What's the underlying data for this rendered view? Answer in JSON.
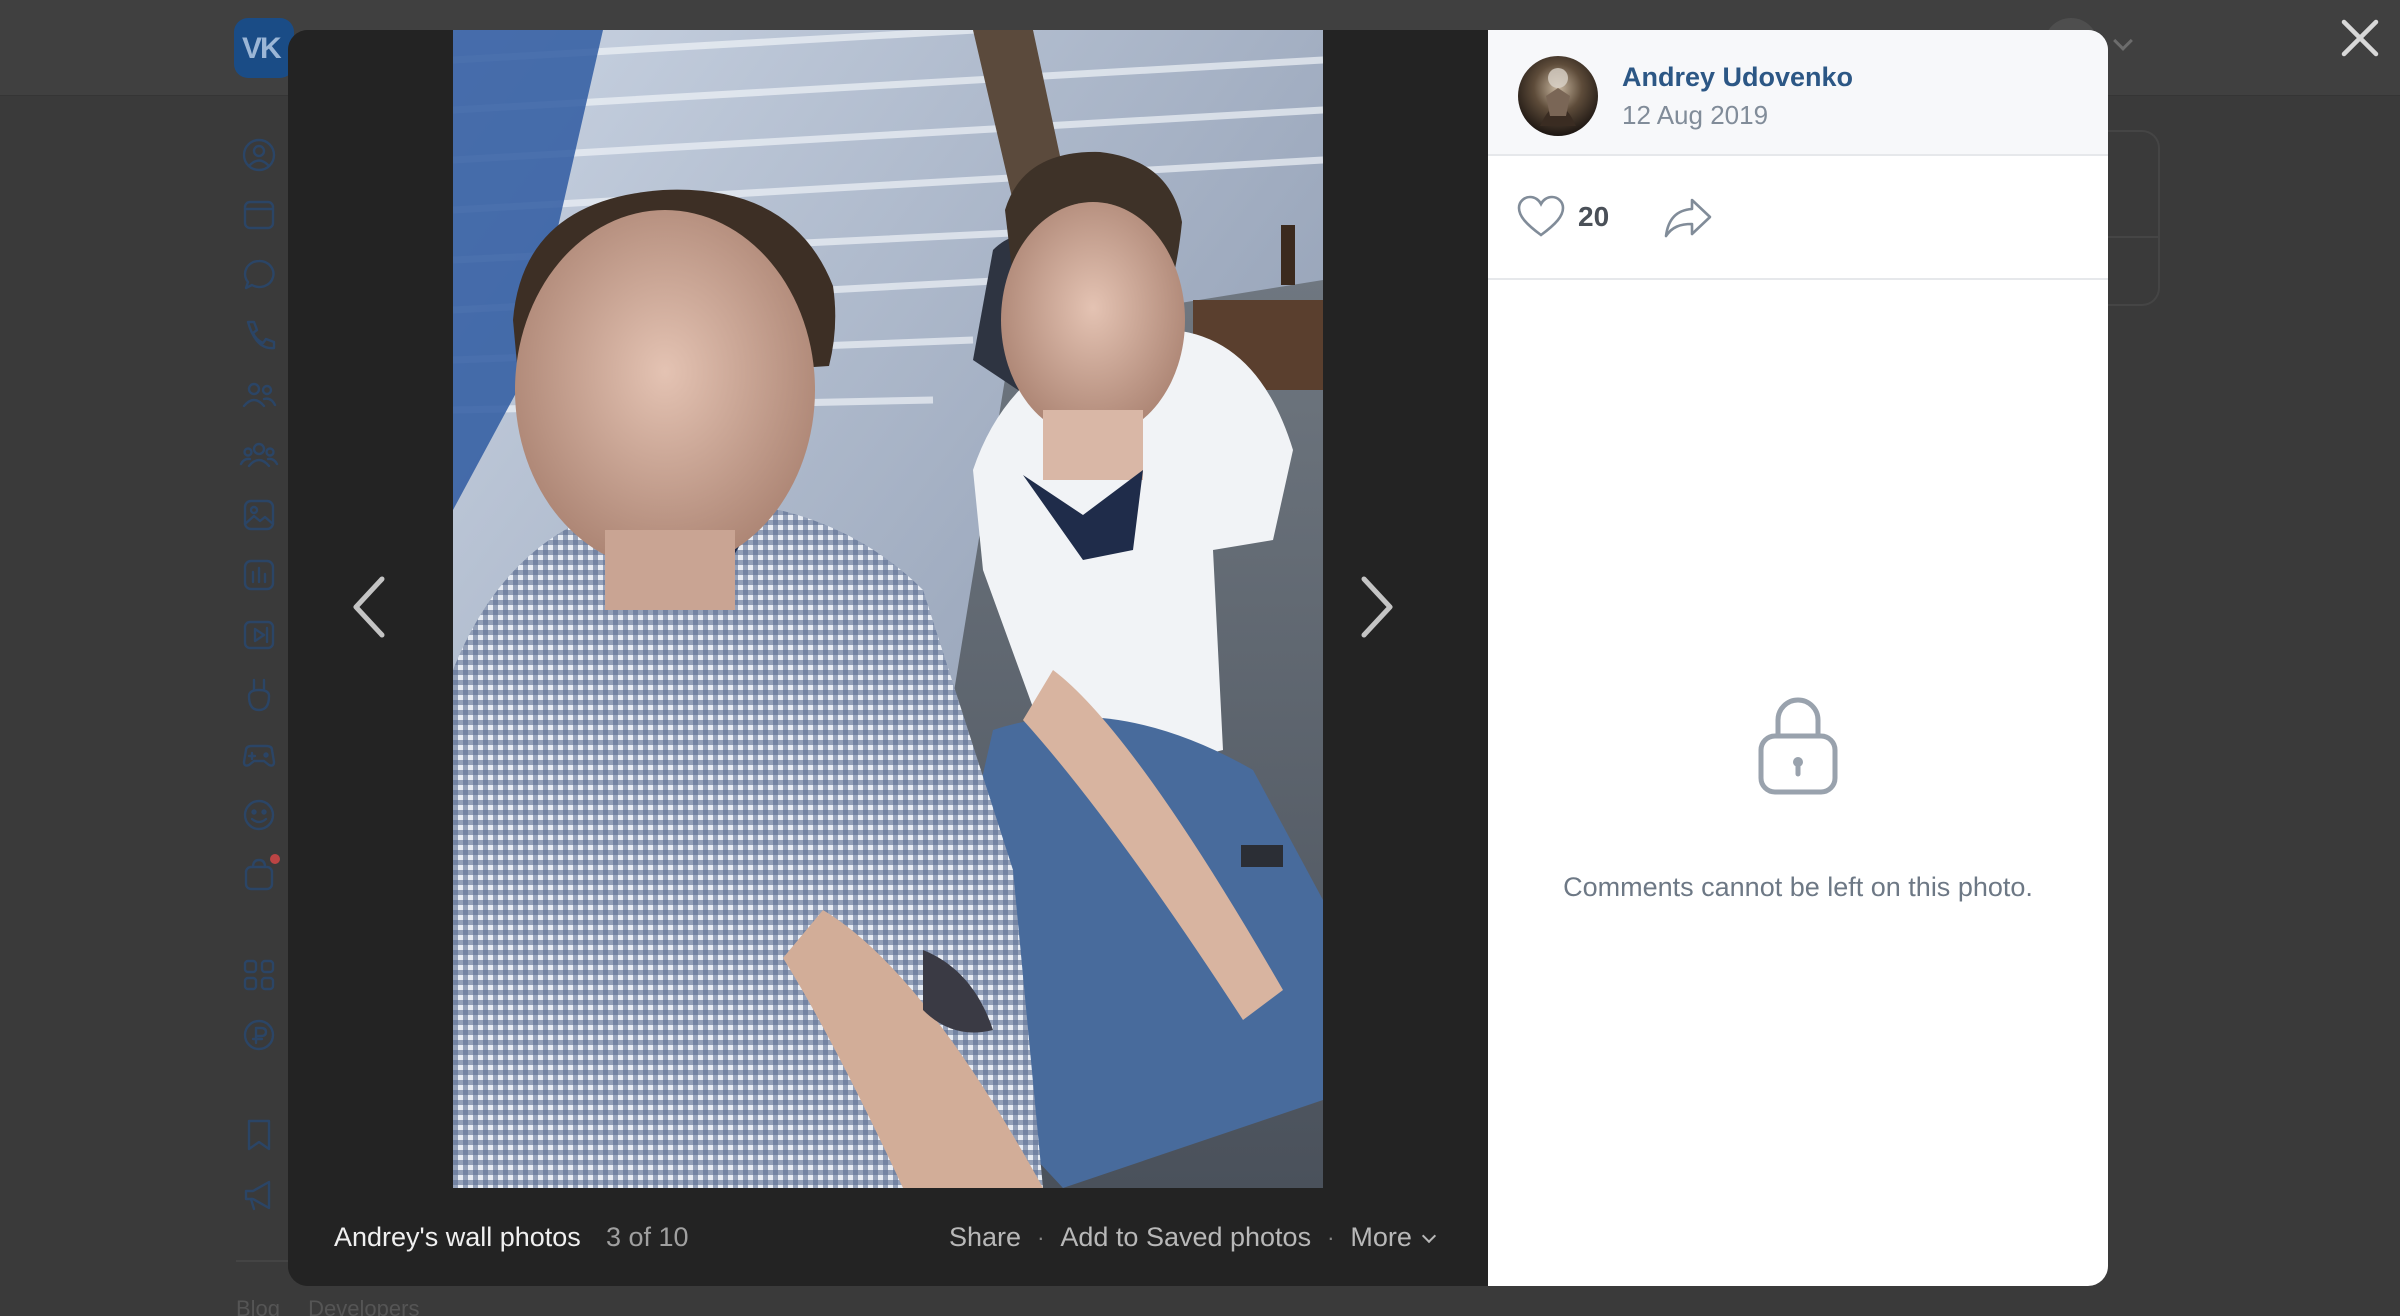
{
  "viewer": {
    "album_title": "Andrey's wall photos",
    "counter": "3 of 10",
    "actions": {
      "share": "Share",
      "add_saved": "Add to Saved photos",
      "more": "More",
      "separator": "·"
    }
  },
  "post": {
    "author_name": "Andrey Udovenko",
    "date": "12 Aug 2019",
    "likes": "20"
  },
  "comments": {
    "locked_message": "Comments cannot be left on this photo."
  },
  "background": {
    "logo_text": "VK",
    "footer_links": [
      "Blog",
      "Developers"
    ]
  },
  "colors": {
    "author_link": "#2c5785",
    "muted_text": "#818c99",
    "overlay": "#232323"
  }
}
